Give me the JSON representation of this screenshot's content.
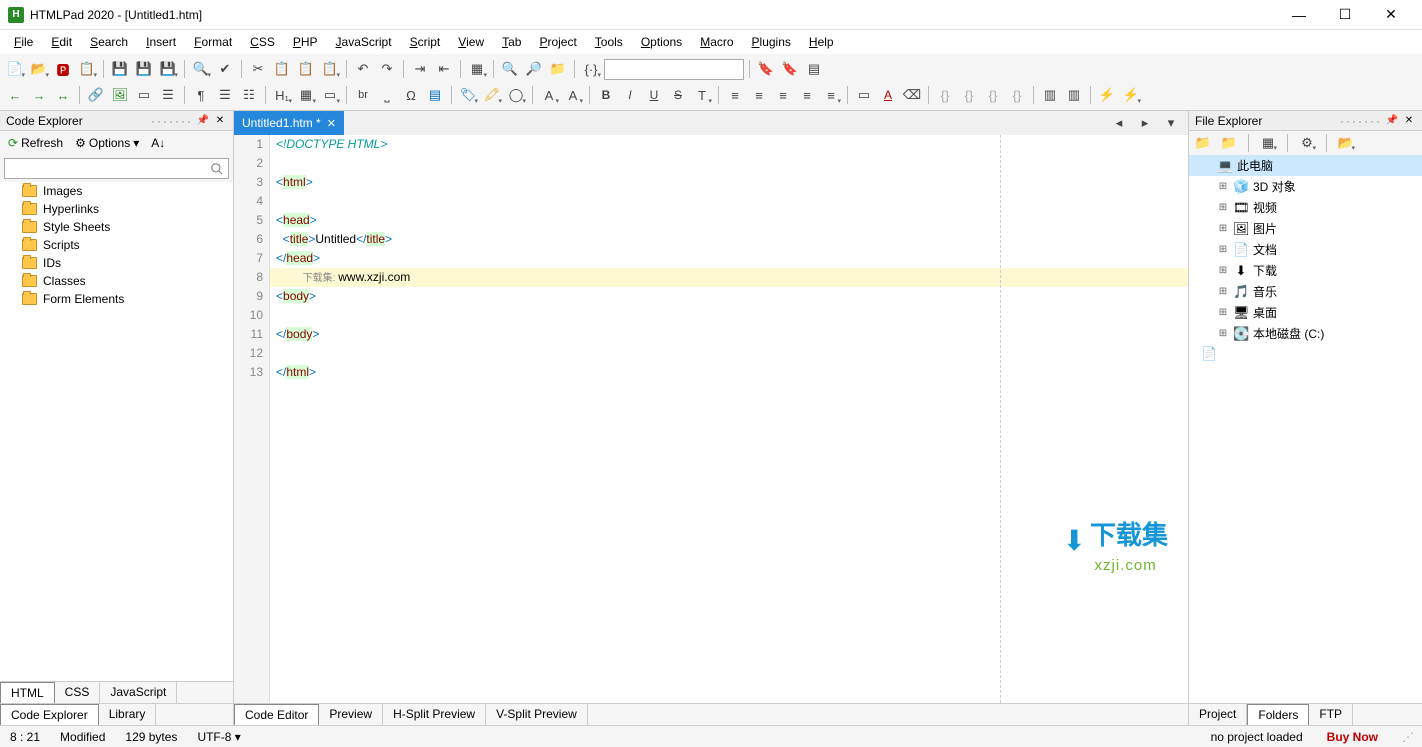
{
  "title": "HTMLPad 2020 - [Untitled1.htm]",
  "menu": [
    "File",
    "Edit",
    "Search",
    "Insert",
    "Format",
    "CSS",
    "PHP",
    "JavaScript",
    "Script",
    "View",
    "Tab",
    "Project",
    "Tools",
    "Options",
    "Macro",
    "Plugins",
    "Help"
  ],
  "leftPanel": {
    "title": "Code Explorer",
    "refresh": "Refresh",
    "options": "Options",
    "items": [
      "Images",
      "Hyperlinks",
      "Style Sheets",
      "Scripts",
      "IDs",
      "Classes",
      "Form Elements"
    ],
    "footerTabs": [
      "HTML",
      "CSS",
      "JavaScript"
    ],
    "bottomTabs": [
      "Code Explorer",
      "Library"
    ]
  },
  "editor": {
    "tab": "Untitled1.htm *",
    "bottomTabs": [
      "Code Editor",
      "Preview",
      "H-Split Preview",
      "V-Split Preview"
    ],
    "lines": [
      {
        "n": "1",
        "segs": [
          {
            "t": "<!DOCTYPE HTML>",
            "cls": "tok-doc"
          }
        ]
      },
      {
        "n": "2",
        "segs": []
      },
      {
        "n": "3",
        "segs": [
          {
            "t": "<",
            "cls": "tok-bracket"
          },
          {
            "t": "html",
            "cls": "tok-tag"
          },
          {
            "t": ">",
            "cls": "tok-bracket"
          }
        ]
      },
      {
        "n": "4",
        "segs": []
      },
      {
        "n": "5",
        "segs": [
          {
            "t": "<",
            "cls": "tok-bracket"
          },
          {
            "t": "head",
            "cls": "tok-tag"
          },
          {
            "t": ">",
            "cls": "tok-bracket"
          }
        ]
      },
      {
        "n": "6",
        "segs": [
          {
            "t": "  ",
            "cls": ""
          },
          {
            "t": "<",
            "cls": "tok-bracket"
          },
          {
            "t": "title",
            "cls": "tok-tag"
          },
          {
            "t": ">",
            "cls": "tok-bracket"
          },
          {
            "t": "Untitled",
            "cls": "tok-text"
          },
          {
            "t": "</",
            "cls": "tok-bracket"
          },
          {
            "t": "title",
            "cls": "tok-tag"
          },
          {
            "t": ">",
            "cls": "tok-bracket"
          }
        ]
      },
      {
        "n": "7",
        "segs": [
          {
            "t": "</",
            "cls": "tok-bracket"
          },
          {
            "t": "head",
            "cls": "tok-tag"
          },
          {
            "t": ">",
            "cls": "tok-bracket"
          }
        ]
      },
      {
        "n": "8",
        "hl": true,
        "segs": [
          {
            "t": "        ",
            "cls": ""
          },
          {
            "t": "下载集: ",
            "cls": "tok-comment"
          },
          {
            "t": "www.xzji.com",
            "cls": "tok-text"
          }
        ]
      },
      {
        "n": "9",
        "segs": [
          {
            "t": "<",
            "cls": "tok-bracket"
          },
          {
            "t": "body",
            "cls": "tok-tag"
          },
          {
            "t": ">",
            "cls": "tok-bracket"
          }
        ]
      },
      {
        "n": "10",
        "segs": []
      },
      {
        "n": "11",
        "segs": [
          {
            "t": "</",
            "cls": "tok-bracket"
          },
          {
            "t": "body",
            "cls": "tok-tag"
          },
          {
            "t": ">",
            "cls": "tok-bracket"
          }
        ]
      },
      {
        "n": "12",
        "segs": []
      },
      {
        "n": "13",
        "segs": [
          {
            "t": "</",
            "cls": "tok-bracket"
          },
          {
            "t": "html",
            "cls": "tok-tag"
          },
          {
            "t": ">",
            "cls": "tok-bracket"
          }
        ]
      }
    ],
    "watermark": {
      "t1": "下载集",
      "t2": "xzji.com"
    }
  },
  "rightPanel": {
    "title": "File Explorer",
    "tree": [
      {
        "lvl": 1,
        "exp": "",
        "icon": "💻",
        "label": "此电脑",
        "sel": true
      },
      {
        "lvl": 2,
        "exp": "⊞",
        "icon": "🧊",
        "label": "3D 对象"
      },
      {
        "lvl": 2,
        "exp": "⊞",
        "icon": "🎞",
        "label": "视频"
      },
      {
        "lvl": 2,
        "exp": "⊞",
        "icon": "🖼",
        "label": "图片"
      },
      {
        "lvl": 2,
        "exp": "⊞",
        "icon": "📄",
        "label": "文档"
      },
      {
        "lvl": 2,
        "exp": "⊞",
        "icon": "⬇",
        "label": "下载"
      },
      {
        "lvl": 2,
        "exp": "⊞",
        "icon": "🎵",
        "label": "音乐"
      },
      {
        "lvl": 2,
        "exp": "⊞",
        "icon": "🖥",
        "label": "桌面"
      },
      {
        "lvl": 2,
        "exp": "⊞",
        "icon": "💽",
        "label": "本地磁盘 (C:)"
      }
    ],
    "bottomTabs": [
      "Project",
      "Folders",
      "FTP"
    ]
  },
  "status": {
    "pos": "8 : 21",
    "mod": "Modified",
    "size": "129 bytes",
    "enc": "UTF-8",
    "proj": "no project loaded",
    "buy": "Buy Now"
  }
}
